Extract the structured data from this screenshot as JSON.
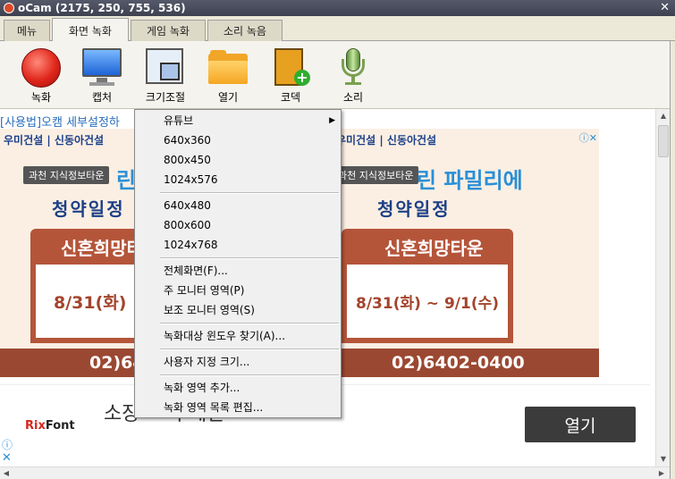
{
  "window": {
    "title": "oCam (2175, 250, 755, 536)",
    "close_label": "✕"
  },
  "tabs": [
    {
      "label": "메뉴"
    },
    {
      "label": "화면 녹화"
    },
    {
      "label": "게임 녹화"
    },
    {
      "label": "소리 녹음"
    }
  ],
  "toolbar": [
    {
      "label": "녹화",
      "icon": "record-icon"
    },
    {
      "label": "캡처",
      "icon": "monitor-icon"
    },
    {
      "label": "크기조절",
      "icon": "resize-icon"
    },
    {
      "label": "열기",
      "icon": "folder-icon"
    },
    {
      "label": "코덱",
      "icon": "codec-icon"
    },
    {
      "label": "소리",
      "icon": "microphone-icon"
    }
  ],
  "browser": {
    "top_link": "[사용법]오캠 세부설정하",
    "ad_banner": {
      "brands": "우미건설 | 신동아건설",
      "chip": "과천 지식정보타운",
      "headline_left": "린",
      "headline_right": "린 파밀리에",
      "subtitle": "청약일정",
      "banner_text": "신혼희망타운",
      "date_left": "8/31(화) ~",
      "date_right": "8/31(화) ~ 9/1(수)",
      "phone_left": "02)64",
      "phone_right": "02)6402-0400",
      "adchoice_icon": "ⓘ✕"
    },
    "ad_bottom": {
      "logo_prefix": "Rix",
      "logo_suffix": "Font",
      "tagline": "소장 ㆍ 무제한",
      "open_button": "열기"
    }
  },
  "context_menu": {
    "items": [
      {
        "label": "유튜브",
        "has_submenu": true,
        "arrow": "▶"
      },
      {
        "label": "640x360"
      },
      {
        "label": "800x450"
      },
      {
        "label": "1024x576"
      },
      {
        "separator": true
      },
      {
        "label": "640x480"
      },
      {
        "label": "800x600"
      },
      {
        "label": "1024x768"
      },
      {
        "separator": true
      },
      {
        "label": "전체화면(F)..."
      },
      {
        "label": "주 모니터 영역(P)"
      },
      {
        "label": "보조 모니터 영역(S)"
      },
      {
        "separator": true
      },
      {
        "label": "녹화대상 윈도우 찾기(A)..."
      },
      {
        "separator": true
      },
      {
        "label": "사용자 지정 크기..."
      },
      {
        "separator": true
      },
      {
        "label": "녹화 영역 추가..."
      },
      {
        "label": "녹화 영역 목록 편집..."
      }
    ]
  }
}
